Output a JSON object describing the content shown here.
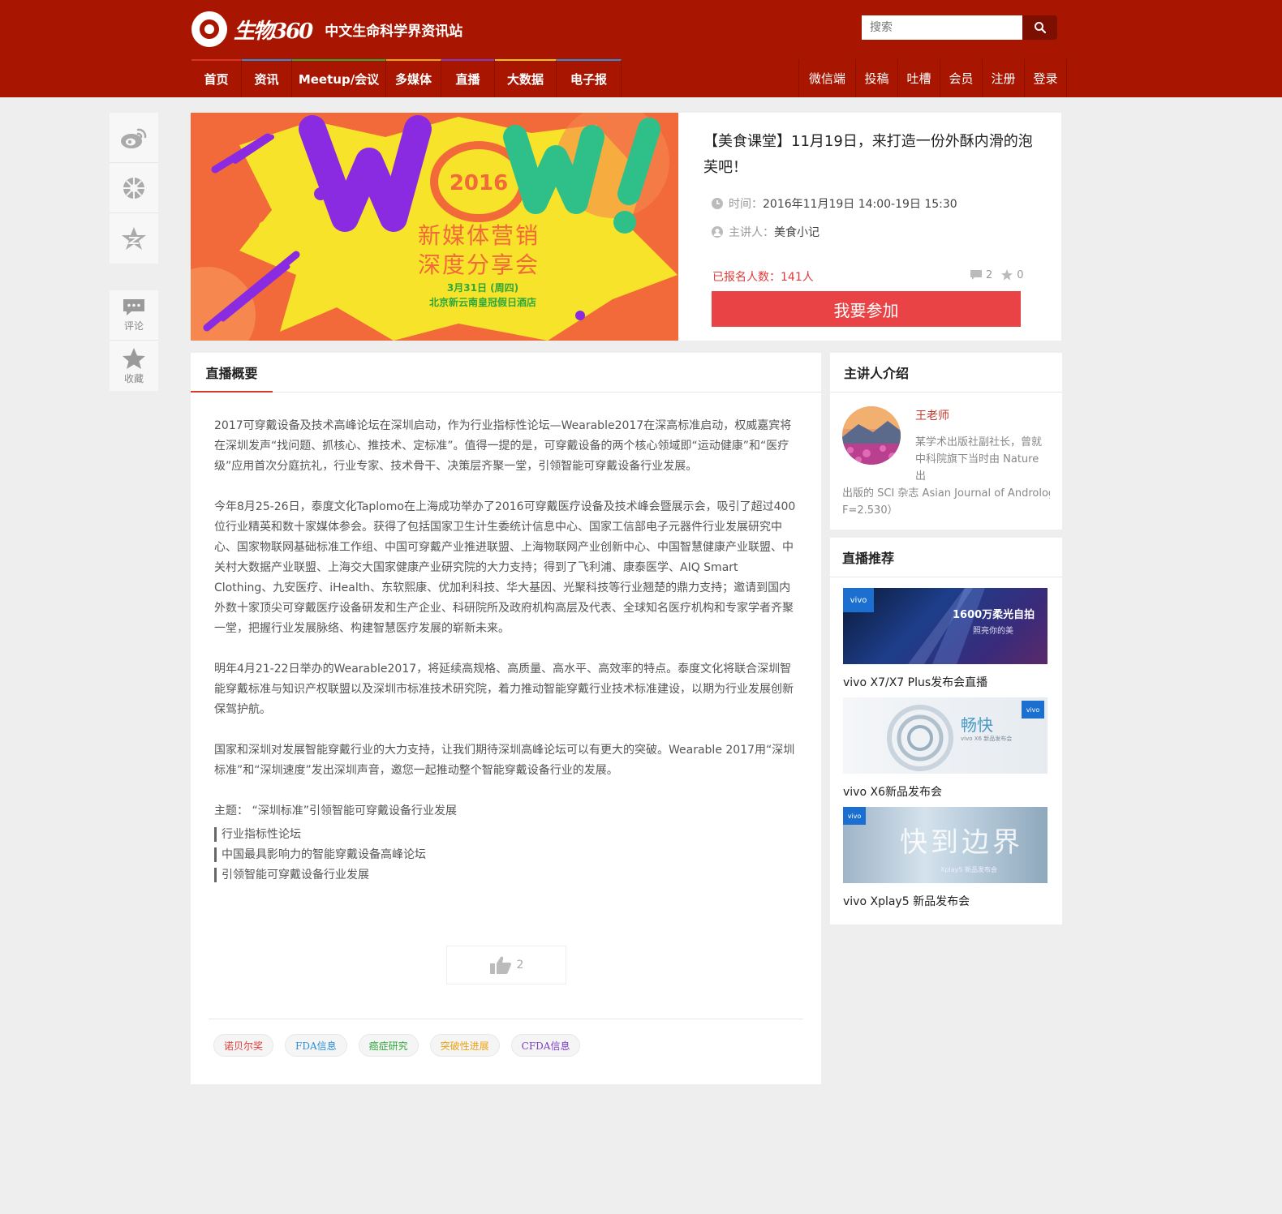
{
  "header": {
    "logo_text": "生物360",
    "slogan": "中文生命科学界资讯站",
    "search_placeholder": "搜索",
    "nav_left": [
      {
        "label": "首页",
        "color": "#d9332b"
      },
      {
        "label": "资讯",
        "color": "#2b8ed9"
      },
      {
        "label": "Meetup/会议",
        "color": "#2fa83a"
      },
      {
        "label": "多媒体",
        "color": "#e8a317"
      },
      {
        "label": "直播",
        "color": "#7a3dc4"
      },
      {
        "label": "大数据",
        "color": "#e8c617"
      },
      {
        "label": "电子报",
        "color": "#2b8ed9"
      }
    ],
    "nav_right": [
      "微信端",
      "投稿",
      "吐槽",
      "会员",
      "注册",
      "登录"
    ]
  },
  "share": {
    "icons": [
      "weibo-icon",
      "wechat-moments-icon",
      "qzone-icon"
    ],
    "comment_label": "评论",
    "favorite_label": "收藏"
  },
  "event": {
    "banner": {
      "year": "2016",
      "line1": "新媒体营销",
      "line2": "深度分享会",
      "date": "3月31日 (周四)",
      "place": "北京新云南皇冠假日酒店"
    },
    "title": "【美食课堂】11月19日，来打造一份外酥内滑的泡芙吧！",
    "time_label": "时间：",
    "time_value": "2016年11月19日 14:00-19日 15:30",
    "host_label": "主讲人：",
    "host_value": "美食小记",
    "reg_label": "已报名人数：",
    "reg_value": "141人",
    "comments": "2",
    "favorites": "0",
    "join_label": "我要参加"
  },
  "main": {
    "tab": "直播概要",
    "paragraphs": [
      " 2017可穿戴设备及技术高峰论坛在深圳启动，作为行业指标性论坛—Wearable2017在深高标准启动，权威嘉宾将在深圳发声“找问题、抓核心、推技术、定标准”。值得一提的是，可穿戴设备的两个核心领域即“运动健康”和“医疗级”应用首次分庭抗礼，行业专家、技术骨干、决策层齐聚一堂，引领智能可穿戴设备行业发展。",
      "今年8月25-26日，泰度文化Taplomo在上海成功举办了2016可穿戴医疗设备及技术峰会暨展示会，吸引了超过400位行业精英和数十家媒体参会。获得了包括国家卫生计生委统计信息中心、国家工信部电子元器件行业发展研究中心、国家物联网基础标准工作组、中国可穿戴产业推进联盟、上海物联网产业创新中心、中国智慧健康产业联盟、中关村大数据产业联盟、上海交大国家健康产业研究院的大力支持；得到了飞利浦、康泰医学、AIQ Smart Clothing、九安医疗、iHealth、东软熙康、优加利科技、华大基因、光聚科技等行业翘楚的鼎力支持；邀请到国内外数十家顶尖可穿戴医疗设备研发和生产企业、科研院所及政府机构高层及代表、全球知名医疗机构和专家学者齐聚一堂，把握行业发展脉络、构建智慧医疗发展的崭新未来。",
      "明年4月21-22日举办的Wearable2017，将延续高规格、高质量、高水平、高效率的特点。泰度文化将联合深圳智能穿戴标准与知识产权联盟以及深圳市标准技术研究院，着力推动智能穿戴行业技术标准建设，以期为行业发展创新保驾护航。",
      "国家和深圳对发展智能穿戴行业的大力支持，让我们期待深圳高峰论坛可以有更大的突破。Wearable 2017用“深圳标准”和“深圳速度”发出深圳声音，邀您一起推动整个智能穿戴设备行业的发展。"
    ],
    "theme": "主题： “深圳标准”引领智能可穿戴设备行业发展",
    "bullets": [
      "行业指标性论坛",
      "中国最具影响力的智能穿戴设备高峰论坛",
      "引领智能可穿戴设备行业发展"
    ],
    "likes": "2",
    "tags": [
      {
        "label": "诺贝尔奖",
        "color": "#e03a3a"
      },
      {
        "label": "FDA信息",
        "color": "#2b8ed9"
      },
      {
        "label": "癌症研究",
        "color": "#2fa83a"
      },
      {
        "label": "突破性进展",
        "color": "#e8a317"
      },
      {
        "label": "CFDA信息",
        "color": "#7a3dc4"
      }
    ]
  },
  "sidebar": {
    "speaker_heading": "主讲人介绍",
    "speaker_name": "王老师",
    "speaker_bio_1": "某学术出版社副社长，曾就",
    "speaker_bio_2": "中科院旗下当时由 Nature 出",
    "speaker_bio_3": "出版的 SCI 杂志 Asian Journal of Andrology",
    "speaker_bio_4": "F=2.530）",
    "rec_heading": "直播推荐",
    "rec": [
      {
        "title": "vivo X7/X7 Plus发布会直播",
        "badge": "vivo",
        "caption": "1600万柔光自拍",
        "sub": "照亮你的美"
      },
      {
        "title": "vivo X6新品发布会",
        "badge": "vivo",
        "caption": "畅快",
        "sub": "vivo X6 新品发布会"
      },
      {
        "title": "vivo Xplay5 新品发布会",
        "badge": "vivo",
        "caption": "快到边界",
        "sub": "Xplay5 新品发布会"
      }
    ]
  }
}
